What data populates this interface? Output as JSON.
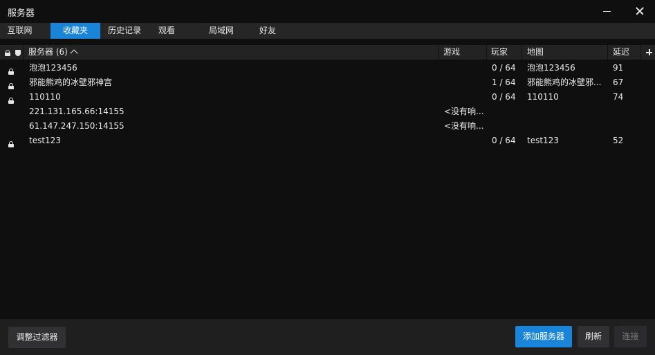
{
  "window": {
    "title": "服务器"
  },
  "tabs": [
    {
      "label": "互联网",
      "active": false
    },
    {
      "label": "收藏夹",
      "active": true
    },
    {
      "label": "历史记录",
      "active": false
    },
    {
      "label": "观看",
      "active": false
    },
    {
      "label": "局域网",
      "active": false
    },
    {
      "label": "好友",
      "active": false
    }
  ],
  "columns": {
    "servers": "服务器 (6)",
    "game": "游戏",
    "players": "玩家",
    "map": "地图",
    "latency": "延迟"
  },
  "servers": [
    {
      "locked": true,
      "name": "泡泡123456",
      "game": "",
      "players": "0 / 64",
      "map": "泡泡123456",
      "latency": "91"
    },
    {
      "locked": true,
      "name": "邪能熊鸡的冰壁邪神宫",
      "game": "",
      "players": "1 / 64",
      "map": "邪能熊鸡的冰壁邪...",
      "latency": "67"
    },
    {
      "locked": true,
      "name": "110110",
      "game": "",
      "players": "0 / 64",
      "map": "110110",
      "latency": "74"
    },
    {
      "locked": false,
      "name": "221.131.165.66:14155",
      "game": "<没有响...",
      "players": "",
      "map": "",
      "latency": ""
    },
    {
      "locked": false,
      "name": "61.147.247.150:14155",
      "game": "<没有响...",
      "players": "",
      "map": "",
      "latency": ""
    },
    {
      "locked": true,
      "name": "test123",
      "game": "",
      "players": "0 / 64",
      "map": "test123",
      "latency": "52"
    }
  ],
  "footer": {
    "filter_label": "调整过滤器",
    "add_label": "添加服务器",
    "refresh_label": "刷新",
    "connect_label": "连接",
    "connect_enabled": false
  },
  "colors": {
    "accent": "#1a84d8",
    "background": "#0f0f10"
  }
}
